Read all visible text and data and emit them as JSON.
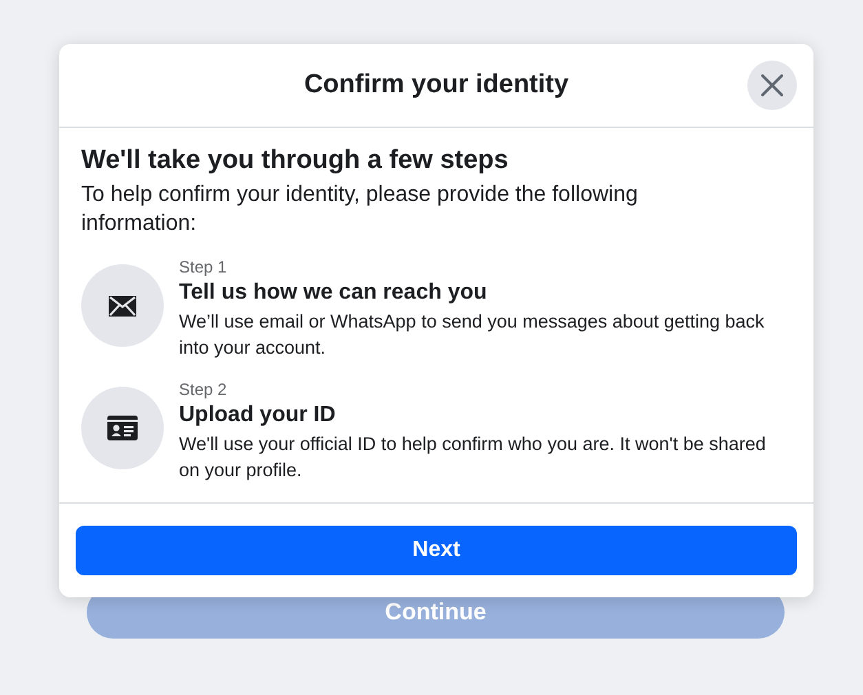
{
  "dialog": {
    "title": "Confirm your identity",
    "heading": "We'll take you through a few steps",
    "intro": "To help confirm your identity, please provide the following information:",
    "steps": [
      {
        "kind": "email",
        "step": "Step 1",
        "title": "Tell us how we can reach you",
        "description": "We’ll use email or WhatsApp to send you messages about getting back into your account."
      },
      {
        "kind": "id",
        "step": "Step 2",
        "title": "Upload your ID",
        "description": "We'll use your official ID to help confirm who you are. It won't be shared on your profile."
      }
    ],
    "primary_button": "Next"
  },
  "background": {
    "button": "Continue",
    "disabled": true
  }
}
